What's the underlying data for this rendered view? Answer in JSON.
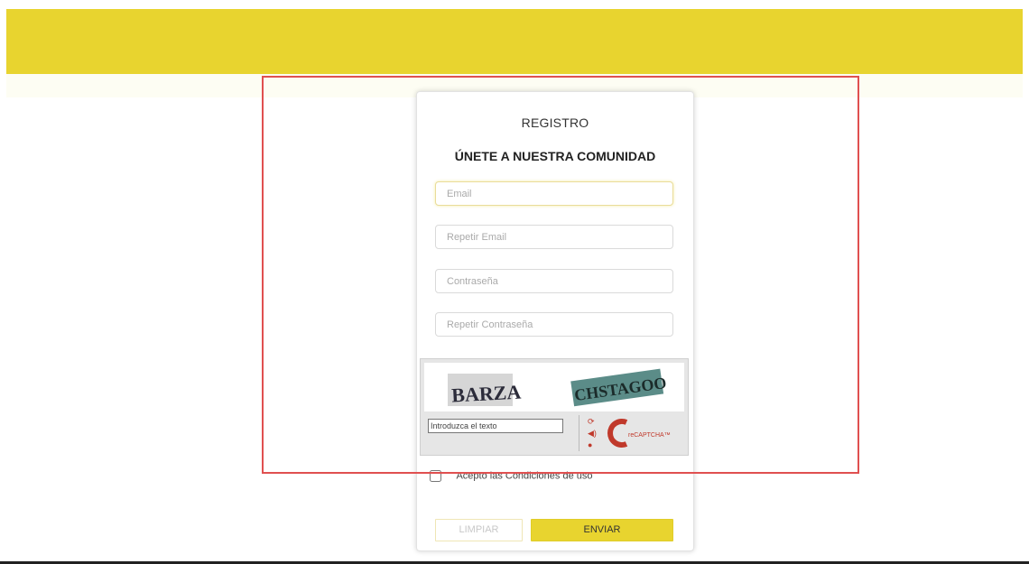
{
  "form": {
    "title": "REGISTRO",
    "subtitle": "ÚNETE A NUESTRA COMUNIDAD",
    "email_placeholder": "Email",
    "repeat_email_placeholder": "Repetir Email",
    "password_placeholder": "Contraseña",
    "repeat_password_placeholder": "Repetir Contraseña",
    "terms_label": "Acepto las Condiciones de uso",
    "clear_label": "LIMPIAR",
    "send_label": "ENVIAR"
  },
  "captcha": {
    "word_left": "BARZA",
    "word_right": "CHSTAGOO",
    "input_placeholder": "Introduzca el texto",
    "logo_text": "reCAPTCHA™",
    "controls": [
      "refresh-icon",
      "audio-icon",
      "help-icon"
    ]
  },
  "colors": {
    "brand_yellow": "#e8d42f",
    "highlight_red": "#e05050",
    "captcha_red": "#c0392b"
  }
}
